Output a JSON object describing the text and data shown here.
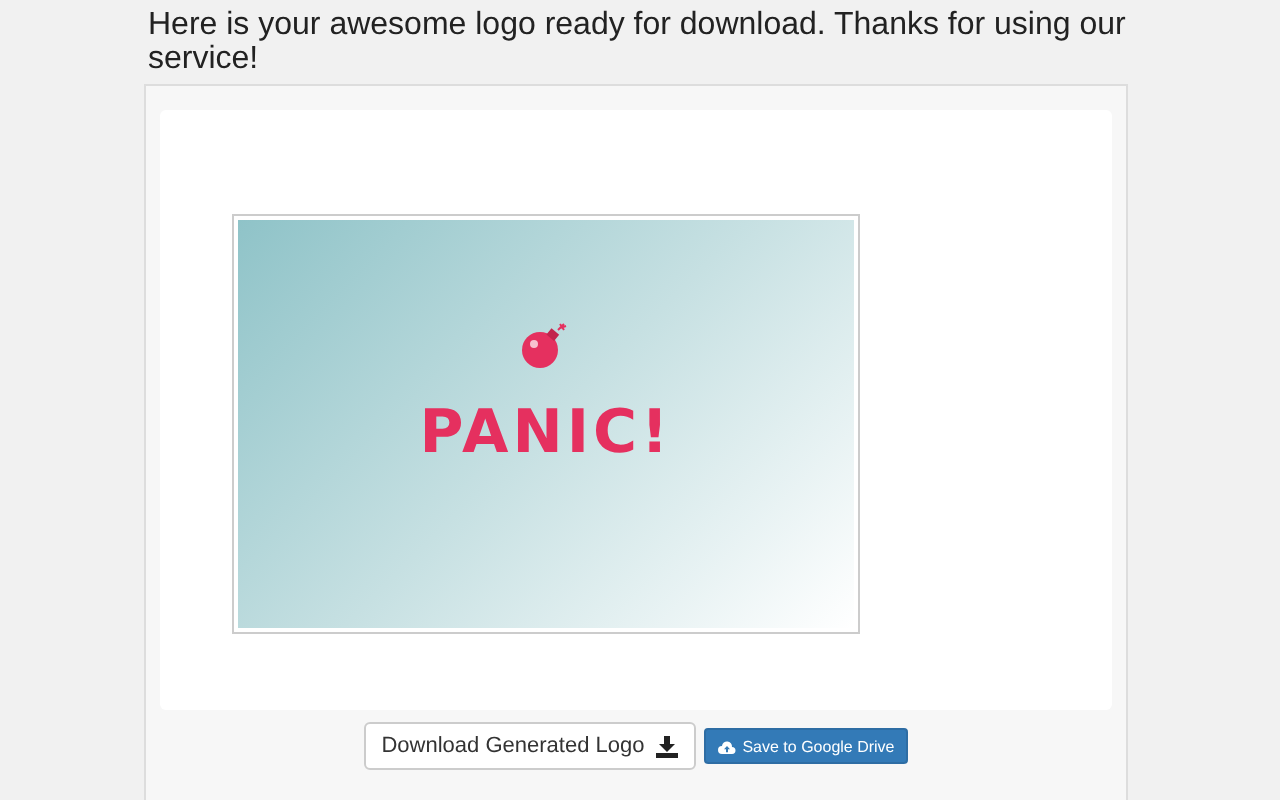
{
  "message": "Here is your awesome logo ready for download. Thanks for using our service!",
  "logo": {
    "name": "PANIC!"
  },
  "buttons": [
    {
      "kind": "download",
      "label": "Download Generated Logo"
    },
    {
      "kind": "drive",
      "label": "Save to Google Drive"
    }
  ]
}
